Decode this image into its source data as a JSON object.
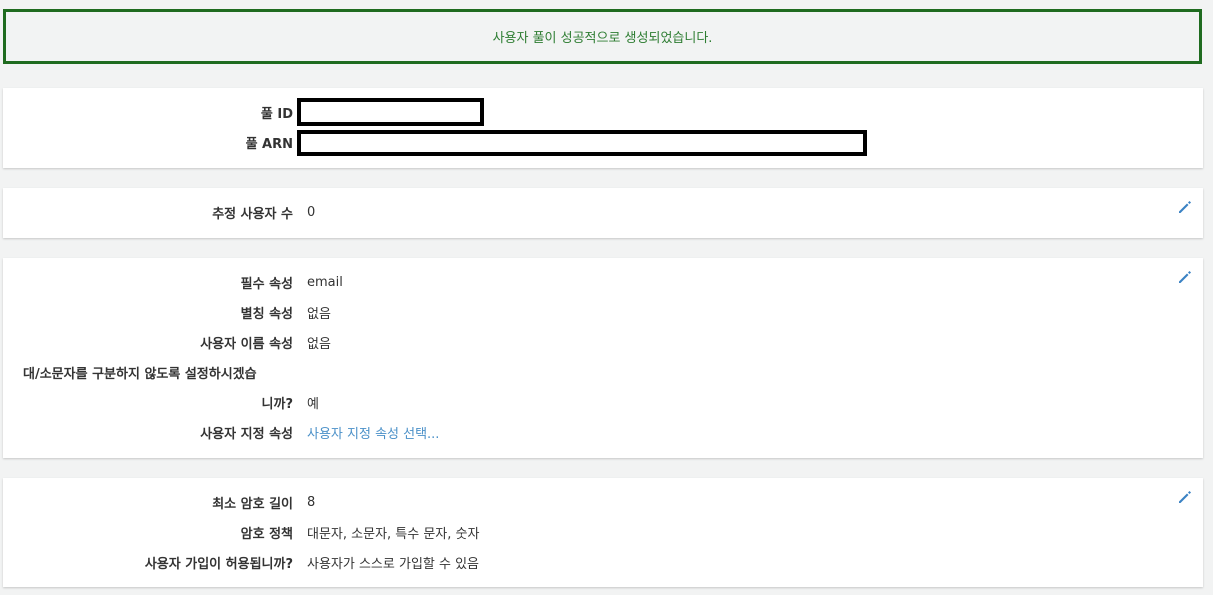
{
  "banner": {
    "message": "사용자 풀이 성공적으로 생성되었습니다."
  },
  "pool_card": {
    "pool_id_label": "풀 ID",
    "pool_arn_label": "풀 ARN"
  },
  "estimate_card": {
    "estimated_users_label": "추정 사용자 수",
    "estimated_users_value": "0"
  },
  "attributes_card": {
    "required_label": "필수 속성",
    "required_value": "email",
    "alias_label": "별칭 속성",
    "alias_value": "없음",
    "username_label": "사용자 이름 속성",
    "username_value": "없음",
    "case_label_line1": "대/소문자를 구분하지 않도록 설정하시겠습",
    "case_label_line2": "니까?",
    "case_value": "예",
    "custom_label": "사용자 지정 속성",
    "custom_value": "사용자 지정 속성 선택..."
  },
  "password_card": {
    "min_length_label": "최소 암호 길이",
    "min_length_value": "8",
    "policy_label": "암호 정책",
    "policy_value": "대문자, 소문자, 특수 문자, 숫자",
    "signup_label": "사용자 가입이 허용됩니까?",
    "signup_value": "사용자가 스스로 가입할 수 있음"
  },
  "icons": {
    "edit": "pencil-icon"
  },
  "colors": {
    "banner_border": "#1f6b1f",
    "banner_text": "#2e7d32",
    "link": "#4a90c8",
    "edit_icon": "#3b82c4"
  }
}
